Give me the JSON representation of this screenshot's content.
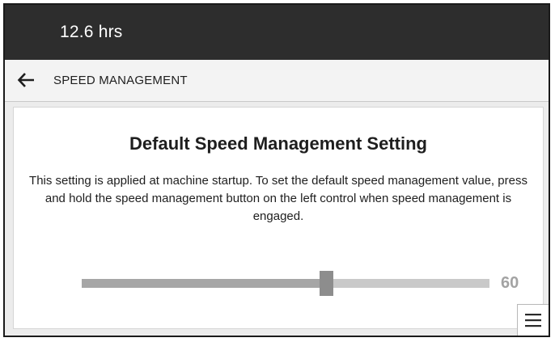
{
  "status_bar": {
    "hours": "12.6 hrs"
  },
  "nav": {
    "back_icon": "arrow-left-icon",
    "title": "SPEED MANAGEMENT"
  },
  "setting": {
    "title": "Default Speed Management Setting",
    "description": "This setting is applied at machine startup. To set the default speed management value, press and hold the speed management button on the left control when speed management is engaged.",
    "slider": {
      "value": 60,
      "value_label": "60",
      "fraction": 0.6
    }
  },
  "menu": {
    "icon": "hamburger-menu-icon"
  },
  "colors": {
    "status_bar_bg": "#2d2d2d",
    "nav_bar_bg": "#f3f3f3",
    "slider_track": "#c9c9c9",
    "slider_thumb": "#8d8d8d"
  }
}
